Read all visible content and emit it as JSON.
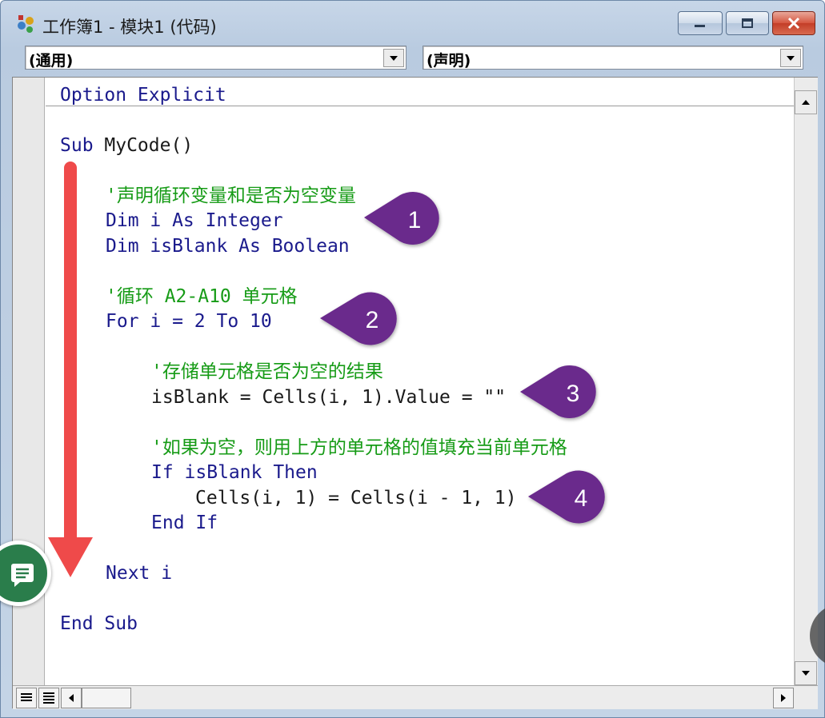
{
  "window": {
    "title": "工作簿1 - 模块1 (代码)"
  },
  "combos": {
    "object_value": "(通用)",
    "procedure_value": "(声明)"
  },
  "code": {
    "lines": [
      {
        "text": "Option Explicit",
        "kind": "kw"
      },
      {
        "text": "Sub MyCode()",
        "kind": "mixed",
        "parts": [
          {
            "t": "Sub ",
            "k": "kw"
          },
          {
            "t": "MyCode()",
            "k": "tx"
          }
        ]
      },
      {
        "text": "'声明循环变量和是否为空变量",
        "kind": "cm"
      },
      {
        "text": "Dim i As Integer",
        "kind": "kw"
      },
      {
        "text": "Dim isBlank As Boolean",
        "kind": "kw"
      },
      {
        "text": "'循环 A2-A10 单元格",
        "kind": "cm"
      },
      {
        "text": "For i = 2 To 10",
        "kind": "kw"
      },
      {
        "text": "'存储单元格是否为空的结果",
        "kind": "cm"
      },
      {
        "text": "isBlank = Cells(i, 1).Value = \"\"",
        "kind": "tx"
      },
      {
        "text": "'如果为空，则用上方的单元格的值填充当前单元格",
        "kind": "cm"
      },
      {
        "text": "If isBlank Then",
        "kind": "kw"
      },
      {
        "text": "Cells(i, 1) = Cells(i - 1, 1)",
        "kind": "tx"
      },
      {
        "text": "End If",
        "kind": "kw"
      },
      {
        "text": "Next i",
        "kind": "kw"
      },
      {
        "text": "End Sub",
        "kind": "kw"
      }
    ]
  },
  "callouts": [
    "1",
    "2",
    "3",
    "4"
  ],
  "colors": {
    "keyword": "#1a1a8c",
    "comment": "#169b16",
    "callout": "#6a2b8c",
    "arrow": "#ef4a4a",
    "comment_fab": "#2a7d4b"
  },
  "icons": {
    "app": "vba-module-icon",
    "fab": "comment-icon"
  }
}
